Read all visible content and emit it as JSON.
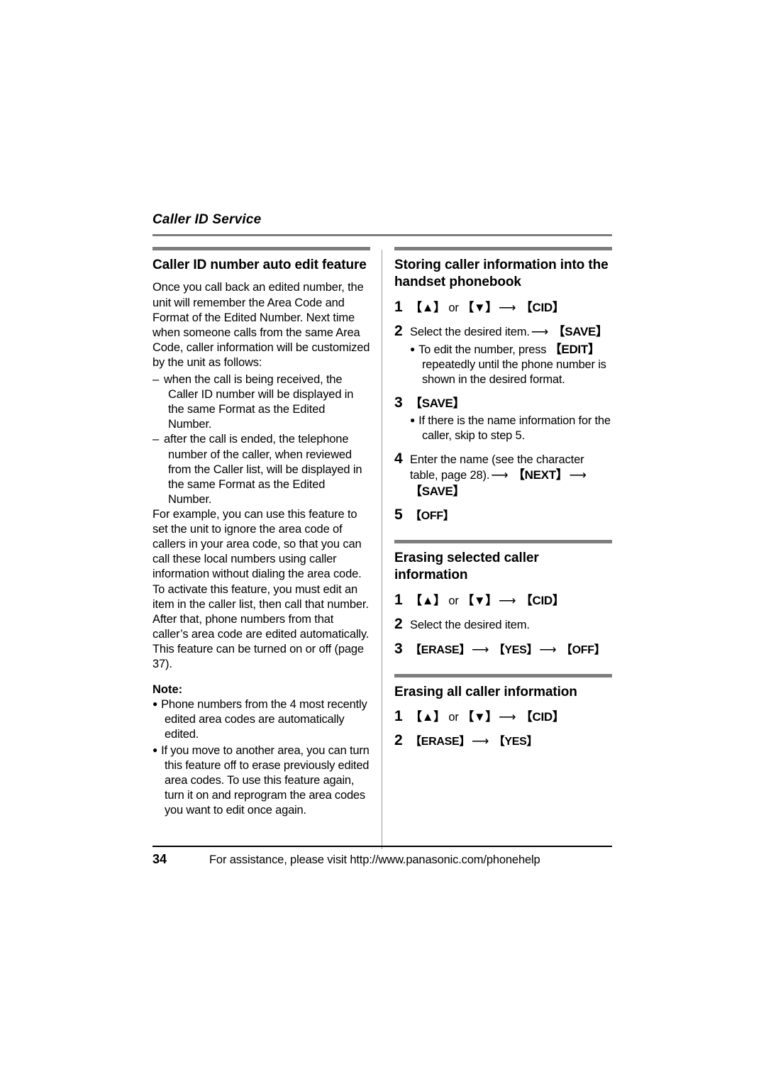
{
  "running_head": "Caller ID Service",
  "colors": {
    "rule_gray": "#7d7d7d",
    "divider_gray": "#9a9a9a",
    "text": "#000000",
    "background": "#ffffff"
  },
  "left_column": {
    "section": {
      "title": "Caller ID number auto edit feature",
      "intro": "Once you call back an edited number, the unit will remember the Area Code and Format of the Edited Number. Next time when someone calls from the same Area Code, caller information will be customized by the unit as follows:",
      "dash_items": [
        "when the call is being received, the Caller ID number will be displayed in the same Format as the Edited Number.",
        "after the call is ended, the telephone number of the caller, when reviewed from the Caller list, will be displayed in the same Format as the Edited Number."
      ],
      "dash_marker": "–",
      "outro": "For example, you can use this feature to set the unit to ignore the area code of callers in your area code, so that you can call these local numbers using caller information without dialing the area code. To activate this feature, you must edit an item in the caller list, then call that number. After that, phone numbers from that caller’s area code are edited automatically. This feature can be turned on or off (page 37).",
      "note_heading": "Note:",
      "note_bullets": [
        "Phone numbers from the 4 most recently edited area codes are automatically edited.",
        "If you move to another area, you can turn this feature off to erase previously edited area codes. To use this feature again, turn it on and reprogram the area codes you want to edit once again."
      ]
    }
  },
  "right_column": {
    "sections": [
      {
        "title": "Storing caller information into the handset phonebook",
        "steps": [
          {
            "num": "1",
            "parts": [
              {
                "type": "key",
                "text": "【▲】"
              },
              {
                "type": "text",
                "text": " or "
              },
              {
                "type": "key",
                "text": "【▼】"
              },
              {
                "type": "arrow",
                "text": "⟶"
              },
              {
                "type": "key",
                "text": "【CID】"
              }
            ]
          },
          {
            "num": "2",
            "parts": [
              {
                "type": "text",
                "text": "Select the desired item."
              },
              {
                "type": "arrow",
                "text": "⟶"
              },
              {
                "type": "key",
                "text": "【SAVE】"
              }
            ],
            "bullets": [
              {
                "parts": [
                  {
                    "type": "text",
                    "text": "To edit the number, press "
                  },
                  {
                    "type": "key",
                    "text": "【EDIT】"
                  },
                  {
                    "type": "text",
                    "text": " repeatedly until the phone number is shown in the desired format."
                  }
                ]
              }
            ]
          },
          {
            "num": "3",
            "parts": [
              {
                "type": "key",
                "text": "【SAVE】"
              }
            ],
            "bullets": [
              {
                "parts": [
                  {
                    "type": "text",
                    "text": "If there is the name information for the caller, skip to step 5."
                  }
                ]
              }
            ]
          },
          {
            "num": "4",
            "parts": [
              {
                "type": "text",
                "text": "Enter the name (see the character table, page 28)."
              },
              {
                "type": "arrow",
                "text": "⟶"
              },
              {
                "type": "key",
                "text": "【NEXT】"
              },
              {
                "type": "arrow",
                "text": "⟶"
              },
              {
                "type": "key",
                "text": "【SAVE】"
              }
            ]
          },
          {
            "num": "5",
            "parts": [
              {
                "type": "key-sm",
                "text": "【OFF】"
              }
            ]
          }
        ]
      },
      {
        "title": "Erasing selected caller information",
        "steps": [
          {
            "num": "1",
            "parts": [
              {
                "type": "key",
                "text": "【▲】"
              },
              {
                "type": "text",
                "text": " or "
              },
              {
                "type": "key",
                "text": "【▼】"
              },
              {
                "type": "arrow",
                "text": "⟶"
              },
              {
                "type": "key",
                "text": "【CID】"
              }
            ]
          },
          {
            "num": "2",
            "parts": [
              {
                "type": "text",
                "text": "Select the desired item."
              }
            ]
          },
          {
            "num": "3",
            "parts": [
              {
                "type": "key-sm",
                "text": "【ERASE】"
              },
              {
                "type": "arrow",
                "text": "⟶"
              },
              {
                "type": "key-sm",
                "text": "【YES】"
              },
              {
                "type": "arrow",
                "text": "⟶"
              },
              {
                "type": "key-sm",
                "text": "【OFF】"
              }
            ]
          }
        ]
      },
      {
        "title": "Erasing all caller information",
        "steps": [
          {
            "num": "1",
            "parts": [
              {
                "type": "key",
                "text": "【▲】"
              },
              {
                "type": "text",
                "text": " or "
              },
              {
                "type": "key",
                "text": "【▼】"
              },
              {
                "type": "arrow",
                "text": "⟶"
              },
              {
                "type": "key",
                "text": "【CID】"
              }
            ]
          },
          {
            "num": "2",
            "parts": [
              {
                "type": "key-sm",
                "text": "【ERASE】"
              },
              {
                "type": "arrow",
                "text": "⟶"
              },
              {
                "type": "key-sm",
                "text": "【YES】"
              }
            ]
          }
        ]
      }
    ]
  },
  "footer": {
    "page_number": "34",
    "assistance_text": "For assistance, please visit http://www.panasonic.com/phonehelp"
  }
}
